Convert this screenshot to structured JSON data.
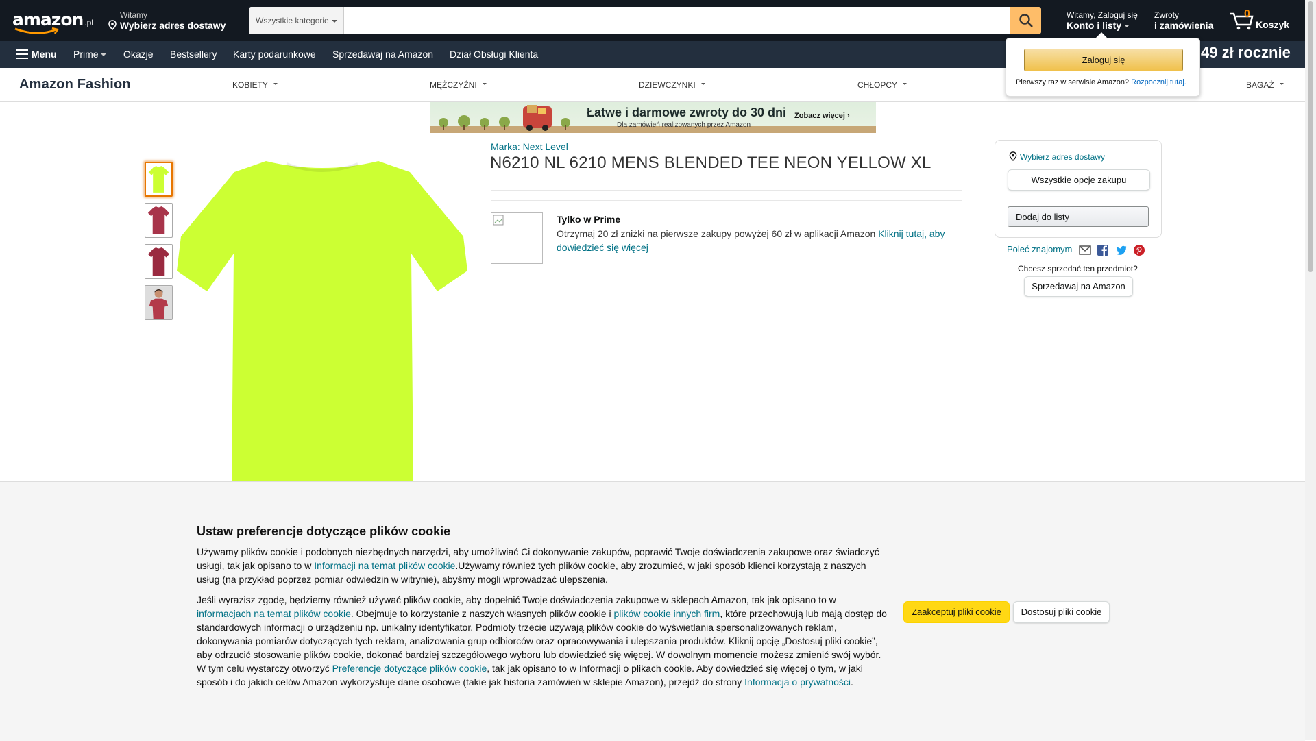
{
  "nav": {
    "logo": "amazon",
    "logo_tld": ".pl",
    "deliver_line1": "Witamy",
    "deliver_line2": "Wybierz adres dostawy",
    "search_category": "Wszystkie kategorie",
    "search_placeholder": "",
    "account_line1": "Witamy, Zaloguj się",
    "account_line2": "Konto i listy",
    "returns_line1": "Zwroty",
    "returns_line2": "i zamówienia",
    "cart_count": "0",
    "cart_label": "Koszyk"
  },
  "subnav": {
    "menu": "Menu",
    "items": [
      "Prime",
      "Okazje",
      "Bestsellery",
      "Karty podarunkowe",
      "Sprzedawaj na Amazon",
      "Dział Obsługi Klienta"
    ],
    "prime_offer": "49 zł rocznie"
  },
  "fashion": {
    "logo": "Amazon Fashion",
    "items": [
      "KOBIETY",
      "MĘŻCZYŹNI",
      "DZIEWCZYNKI",
      "CHŁOPCY",
      "BAGAŻ"
    ]
  },
  "flyout": {
    "signin": "Zaloguj się",
    "new_text": "Pierwszy raz w serwisie Amazon?",
    "start_link": "Rozpocznij tutaj."
  },
  "promo": {
    "title": "Łatwe i darmowe zwroty do 30 dni",
    "subtitle": "Dla zamówień realizowanych przez Amazon",
    "more": "Zobacz więcej ›"
  },
  "product": {
    "brand": "Marka: Next Level",
    "title": "N6210 NL 6210 MENS BLENDED TEE NEON YELLOW XL",
    "main_color": "#ccff33",
    "thumb_colors": [
      "#ccff33",
      "#a8344a",
      "#9a2a40",
      "#b33a4a"
    ],
    "prime_title": "Tylko w Prime",
    "prime_text": "Otrzymaj 20 zł zniżki na pierwsze zakupy powyżej 60 zł w aplikacji Amazon ",
    "prime_link": "Kliknij tutaj, aby dowiedzieć się więcej"
  },
  "buybox": {
    "address": "Wybierz adres dostawy",
    "all_options": "Wszystkie opcje zakupu",
    "add_to_list": "Dodaj do listy",
    "share": "Poleć znajomym",
    "share_icons": [
      "mail-icon",
      "facebook-icon",
      "twitter-icon",
      "pinterest-icon"
    ],
    "sell_question": "Chcesz sprzedać ten przedmiot?",
    "sell_button": "Sprzedawaj na Amazon"
  },
  "cookie": {
    "title": "Ustaw preferencje dotyczące plików cookie",
    "p1a": "Używamy plików cookie i podobnych niezbędnych narzędzi, aby umożliwiać Ci dokonywanie zakupów, poprawić Twoje doświadczenia zakupowe oraz świadczyć usługi, tak jak opisano to w ",
    "p1_link": "Informacji na temat plików cookie",
    "p1b": ".Używamy również tych plików cookie, aby zrozumieć, w jaki sposób klienci korzystają z naszych usług (na przykład poprzez pomiar odwiedzin w witrynie), abyśmy mogli wprowadzać ulepszenia.",
    "p2a": "Jeśli wyrazisz zgodę, będziemy również używać plików cookie, aby dopełnić Twoje doświadczenia zakupowe w sklepach Amazon, tak jak opisano to w ",
    "p2_link1": "informacjach na temat plików cookie",
    "p2b": ". Obejmuje to korzystanie z naszych własnych plików cookie i ",
    "p2_link2": "plików cookie innych firm",
    "p2c": ", które przechowują lub mają dostęp do standardowych informacji o urządzeniu np. unikalny identyfikator. Podmioty trzecie używają plików cookie do wyświetlania spersonalizowanych reklam, dokonywania pomiarów dotyczących tych reklam, analizowania grup odbiorców oraz opracowywania i ulepszania produktów. Kliknij opcję „Dostosuj pliki cookie”, aby odrzucić stosowanie plików cookie, dokonać bardziej szczegółowego wyboru lub dowiedzieć się więcej. W dowolnym momencie możesz zmienić swój wybór. W tym celu wystarczy otworzyć ",
    "p2_link3": "Preferencje dotyczące plików cookie",
    "p2d": ", tak jak opisano to w Informacji o plikach cookie. Aby dowiedzieć się więcej o tym, w jaki sposób i do jakich celów Amazon wykorzystuje dane osobowe (takie jak historia zamówień w sklepie Amazon), przejdź do strony ",
    "p2_link4": "Informacja o prywatności",
    "p2e": ".",
    "accept": "Zaakceptuj pliki cookie",
    "customize": "Dostosuj pliki cookie"
  }
}
